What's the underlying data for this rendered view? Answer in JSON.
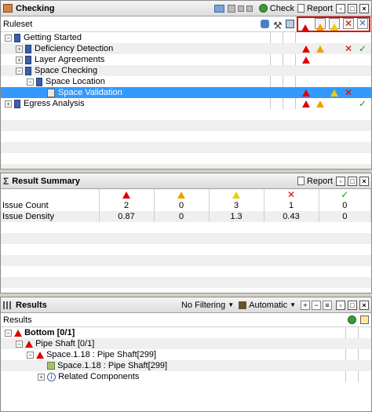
{
  "checking": {
    "title": "Checking",
    "check_label": "Check",
    "report_label": "Report",
    "column_header": "Ruleset",
    "rows": [
      {
        "label": "Getting Started",
        "level": 0,
        "expander": "−",
        "icons": []
      },
      {
        "label": "Deficiency Detection",
        "level": 1,
        "expander": "+",
        "icons": [
          "warn-red",
          "warn-orange",
          "",
          "x",
          "check"
        ]
      },
      {
        "label": "Layer Agreements",
        "level": 1,
        "expander": "+",
        "icons": [
          "warn-red",
          "",
          "",
          "",
          ""
        ]
      },
      {
        "label": "Space Checking",
        "level": 1,
        "expander": "−",
        "icons": []
      },
      {
        "label": "Space Location",
        "level": 2,
        "expander": "−",
        "icons": []
      },
      {
        "label": "Space Validation",
        "level": 3,
        "expander": "",
        "icons": [
          "warn-red",
          "",
          "warn-yellow",
          "x",
          ""
        ],
        "selected": true
      },
      {
        "label": "Egress Analysis",
        "level": 0,
        "expander": "+",
        "icons": [
          "warn-red",
          "warn-orange",
          "",
          "",
          "check"
        ]
      }
    ]
  },
  "summary": {
    "title": "Result Summary",
    "report_label": "Report",
    "headers": [
      "warn-red",
      "warn-orange",
      "warn-yellow",
      "x",
      "check"
    ],
    "rows": [
      {
        "label": "Issue Count",
        "values": [
          "2",
          "0",
          "3",
          "1",
          "0"
        ]
      },
      {
        "label": "Issue Density",
        "values": [
          "0.87",
          "0",
          "1.3",
          "0.43",
          "0"
        ]
      }
    ]
  },
  "results": {
    "title": "Results",
    "filter_label": "No Filtering",
    "mode_label": "Automatic",
    "column_header": "Results",
    "rows": [
      {
        "label": "Bottom [0/1]",
        "level": 0,
        "expander": "−",
        "bold": true,
        "icon": "warn-red"
      },
      {
        "label": "Pipe Shaft [0/1]",
        "level": 1,
        "expander": "−",
        "icon": "warn-red"
      },
      {
        "label": "Space.1.18 : Pipe Shaft[299]",
        "level": 2,
        "expander": "−",
        "icon": "warn-red"
      },
      {
        "label": "Space.1.18 : Pipe Shaft[299]",
        "level": 3,
        "expander": "",
        "icon": "cube"
      },
      {
        "label": "Related Components",
        "level": 3,
        "expander": "+",
        "icon": "info"
      }
    ]
  }
}
